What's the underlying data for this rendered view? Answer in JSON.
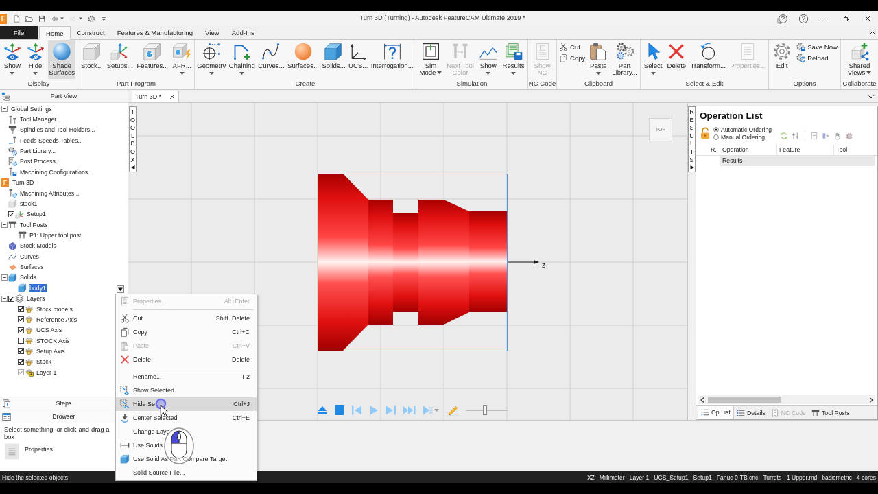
{
  "window": {
    "app_logo": "F",
    "title": "Turn 3D (Turning) - Autodesk FeatureCAM Ultimate 2019 *"
  },
  "quick_access": [
    {
      "kind": "new",
      "disabled": false,
      "dropdown": false
    },
    {
      "kind": "open",
      "disabled": false,
      "dropdown": false
    },
    {
      "kind": "save",
      "disabled": false,
      "dropdown": false
    },
    {
      "kind": "undo",
      "disabled": false,
      "dropdown": true
    },
    {
      "kind": "redo",
      "disabled": true,
      "dropdown": true
    },
    {
      "kind": "settings",
      "disabled": false,
      "dropdown": false
    },
    {
      "kind": "customize",
      "disabled": false,
      "dropdown": false
    }
  ],
  "tabs": [
    {
      "label": "File",
      "kind": "backstage",
      "selected": false
    },
    {
      "label": "Home",
      "kind": "tab",
      "selected": true
    },
    {
      "label": "Construct",
      "kind": "tab",
      "selected": false
    },
    {
      "label": "Features & Manufacturing",
      "kind": "tab",
      "selected": false
    },
    {
      "label": "View",
      "kind": "tab",
      "selected": false
    },
    {
      "label": "Add-Ins",
      "kind": "tab",
      "selected": false
    }
  ],
  "ribbon": {
    "groups": [
      {
        "label": "Display",
        "items": [
          {
            "label": "Show",
            "kind": "show",
            "dropdown": true,
            "disabled": false,
            "on": false
          },
          {
            "label": "Hide",
            "kind": "hide",
            "dropdown": true,
            "disabled": false,
            "on": false
          },
          {
            "label": "Shade\nSurfaces",
            "kind": "shade",
            "dropdown": false,
            "disabled": false,
            "on": true
          }
        ]
      },
      {
        "label": "Part Program",
        "items": [
          {
            "label": "Stock...",
            "kind": "stock",
            "dropdown": false,
            "disabled": false,
            "on": false
          },
          {
            "label": "Setups...",
            "kind": "setups",
            "dropdown": false,
            "disabled": false,
            "on": false
          },
          {
            "label": "Features...",
            "kind": "features",
            "dropdown": false,
            "disabled": false,
            "on": false
          },
          {
            "label": "AFR...",
            "kind": "afr",
            "dropdown": true,
            "disabled": false,
            "on": false
          }
        ]
      },
      {
        "label": "Create",
        "items": [
          {
            "label": "Geometry",
            "kind": "geometry",
            "dropdown": true,
            "disabled": false,
            "on": false
          },
          {
            "label": "Chaining",
            "kind": "chaining",
            "dropdown": true,
            "disabled": false,
            "on": false
          },
          {
            "label": "Curves...",
            "kind": "curves",
            "dropdown": false,
            "disabled": false,
            "on": false
          },
          {
            "label": "Surfaces...",
            "kind": "surfaces",
            "dropdown": false,
            "disabled": false,
            "on": false
          },
          {
            "label": "Solids...",
            "kind": "solids",
            "dropdown": false,
            "disabled": false,
            "on": false
          },
          {
            "label": "UCS...",
            "kind": "ucs",
            "dropdown": false,
            "disabled": false,
            "on": false
          },
          {
            "label": "Interrogation...",
            "kind": "interrogation",
            "dropdown": false,
            "disabled": false,
            "on": false
          }
        ]
      },
      {
        "label": "Simulation",
        "items": [
          {
            "label": "Sim\nMode",
            "kind": "simmode",
            "dropdown": true,
            "disabled": false,
            "on": false
          },
          {
            "label": "Next Tool\nColor",
            "kind": "nexttool",
            "dropdown": false,
            "disabled": true,
            "on": false
          },
          {
            "label": "Show",
            "kind": "graph",
            "dropdown": true,
            "disabled": false,
            "on": false
          },
          {
            "label": "Results",
            "kind": "results",
            "dropdown": true,
            "disabled": false,
            "on": false
          }
        ]
      },
      {
        "label": "NC Code",
        "items": [
          {
            "label": "Show\nNC",
            "kind": "shownc",
            "dropdown": false,
            "disabled": true,
            "on": false
          }
        ]
      },
      {
        "label": "Clipboard",
        "items": [
          {
            "stack": [
              {
                "label": "Cut",
                "kind": "cut",
                "disabled": false
              },
              {
                "label": "Copy",
                "kind": "copy",
                "disabled": false
              }
            ]
          },
          {
            "label": "Paste",
            "kind": "paste",
            "dropdown": true,
            "disabled": false,
            "on": false
          },
          {
            "label": "Part\nLibrary...",
            "kind": "library",
            "dropdown": false,
            "disabled": false,
            "on": false
          }
        ]
      },
      {
        "label": "Select & Edit",
        "items": [
          {
            "label": "Select",
            "kind": "select",
            "dropdown": true,
            "disabled": false,
            "on": false
          },
          {
            "label": "Delete",
            "kind": "delete",
            "dropdown": false,
            "disabled": false,
            "on": false
          },
          {
            "label": "Transform...",
            "kind": "transform",
            "dropdown": false,
            "disabled": false,
            "on": false
          },
          {
            "label": "Properties...",
            "kind": "properties",
            "dropdown": false,
            "disabled": true,
            "on": false
          }
        ]
      },
      {
        "label": "Options",
        "items": [
          {
            "label": "Edit",
            "kind": "options",
            "dropdown": false,
            "disabled": false,
            "on": false
          },
          {
            "stack": [
              {
                "label": "Save Now",
                "kind": "savenow",
                "disabled": false
              },
              {
                "label": "Reload",
                "kind": "reload",
                "disabled": false
              }
            ]
          }
        ]
      },
      {
        "label": "Collaborate",
        "items": [
          {
            "label": "Shared\nViews",
            "kind": "shared",
            "dropdown": true,
            "disabled": false,
            "on": false
          }
        ]
      }
    ]
  },
  "part_view": {
    "title": "Part View",
    "tree": [
      {
        "label": "Global Settings",
        "kind": "group",
        "expanded": true,
        "selected": false,
        "children": [
          {
            "label": "Tool Manager...",
            "kind": "tools",
            "selected": false
          },
          {
            "label": "Spindles and Tool Holders...",
            "kind": "spindle",
            "selected": false
          },
          {
            "label": "Feeds Speeds Tables...",
            "kind": "feeds",
            "selected": false
          },
          {
            "label": "Part Library...",
            "kind": "library",
            "selected": false
          },
          {
            "label": "Post Process...",
            "kind": "post",
            "selected": false
          },
          {
            "label": "Machining Configurations...",
            "kind": "config",
            "selected": false
          }
        ]
      },
      {
        "label": "Turn 3D",
        "kind": "part",
        "logo": "F",
        "selected": false,
        "children": [
          {
            "label": "Machining Attributes...",
            "kind": "attributes",
            "selected": false
          },
          {
            "label": "stock1",
            "kind": "stock",
            "selected": false
          },
          {
            "label": "Setup1",
            "kind": "setup",
            "checked": true,
            "selected": false
          },
          {
            "label": "Tool Posts",
            "kind": "toolpost",
            "expanded": true,
            "selected": false,
            "children": [
              {
                "label": "P1: Upper tool post",
                "kind": "toolpost",
                "selected": false
              }
            ]
          },
          {
            "label": "Stock Models",
            "kind": "stockmodel",
            "selected": false
          },
          {
            "label": "Curves",
            "kind": "curve",
            "selected": false
          },
          {
            "label": "Surfaces",
            "kind": "surface",
            "selected": false
          },
          {
            "label": "Solids",
            "kind": "solid",
            "expanded": true,
            "selected": false,
            "children": [
              {
                "label": "body1",
                "kind": "solid",
                "selected": true
              }
            ]
          },
          {
            "label": "Layers",
            "kind": "layers",
            "checked": true,
            "expanded": true,
            "selected": false,
            "children": [
              {
                "label": "Stock models",
                "kind": "layer",
                "checked": true,
                "disabled": false,
                "selected": false
              },
              {
                "label": "Reference Axis",
                "kind": "layer",
                "checked": true,
                "disabled": false,
                "selected": false
              },
              {
                "label": "UCS Axis",
                "kind": "layer",
                "checked": true,
                "disabled": false,
                "selected": false
              },
              {
                "label": "STOCK Axis",
                "kind": "layer",
                "checked": false,
                "disabled": false,
                "selected": false
              },
              {
                "label": "Setup Axis",
                "kind": "layer",
                "checked": true,
                "disabled": false,
                "selected": false
              },
              {
                "label": "Stock",
                "kind": "layer",
                "checked": true,
                "disabled": false,
                "selected": false
              },
              {
                "label": "Layer 1",
                "kind": "current",
                "checked": true,
                "disabled": true,
                "selected": false
              }
            ]
          }
        ]
      }
    ],
    "steps": "Steps",
    "browser": "Browser",
    "hint": "Select something, or click-and-drag a box",
    "properties": "Properties"
  },
  "document": {
    "tabs": [
      {
        "label": "Turn 3D *",
        "selected": true
      }
    ],
    "toolbox": "TOOLBOX",
    "results_tab": "RESULTS",
    "view_cube": "TOP",
    "axis_label": "z",
    "speed": {
      "level": 0.45
    }
  },
  "operation_list": {
    "title": "Operation List",
    "ordering": [
      {
        "label": "Automatic Ordering",
        "selected": true
      },
      {
        "label": "Manual Ordering",
        "selected": false
      }
    ],
    "columns": [
      "R.",
      "Operation",
      "Feature",
      "Tool"
    ],
    "rows": [
      {
        "operation": "Results"
      }
    ],
    "tabs": [
      {
        "label": "Op List",
        "kind": "list",
        "selected": true,
        "disabled": false
      },
      {
        "label": "Details",
        "kind": "list",
        "selected": false,
        "disabled": false
      },
      {
        "label": "NC Code",
        "kind": "nc",
        "selected": false,
        "disabled": true
      },
      {
        "label": "Tool Posts",
        "kind": "toolpost",
        "selected": false,
        "disabled": false
      }
    ]
  },
  "context_menu": {
    "sections": [
      [
        {
          "label": "Properties...",
          "shortcut": "Alt+Enter",
          "kind": "properties",
          "disabled": true,
          "selected": false
        }
      ],
      [
        {
          "label": "Cut",
          "shortcut": "Shift+Delete",
          "kind": "cut",
          "disabled": false,
          "selected": false
        },
        {
          "label": "Copy",
          "shortcut": "Ctrl+C",
          "kind": "copy",
          "disabled": false,
          "selected": false
        },
        {
          "label": "Paste",
          "shortcut": "Ctrl+V",
          "kind": "paste",
          "disabled": true,
          "selected": false
        },
        {
          "label": "Delete",
          "shortcut": "Delete",
          "kind": "delete",
          "disabled": false,
          "selected": false
        }
      ],
      [
        {
          "label": "Rename...",
          "shortcut": "F2",
          "kind": "plain",
          "disabled": false,
          "selected": false
        },
        {
          "label": "Show Selected",
          "kind": "show",
          "disabled": false,
          "selected": false
        },
        {
          "label": "Hide Se",
          "shortcut": "Ctrl+J",
          "kind": "hide",
          "disabled": false,
          "selected": true
        },
        {
          "label": "Center Selected",
          "shortcut": "Ctrl+E",
          "kind": "center",
          "disabled": false,
          "selected": false
        },
        {
          "label": "Change Laye",
          "kind": "plain",
          "disabled": false,
          "selected": false
        },
        {
          "label": "Use Solids",
          "kind": "solids",
          "disabled": false,
          "selected": false
        },
        {
          "label": "Use Solid As Part Compare Target",
          "kind": "compare",
          "disabled": false,
          "selected": false
        },
        {
          "label": "Solid Source File...",
          "kind": "plain",
          "disabled": false,
          "selected": false
        }
      ]
    ]
  },
  "status_bar": {
    "message": "Hide the selected objects",
    "fields": [
      "XZ",
      "Millimeter",
      "Layer 1",
      "UCS_Setup1",
      "Setup1",
      "Fanuc 0-TB.cnc",
      "Turrets - 1 Upper.md",
      "basicmetric",
      "4 cores"
    ]
  }
}
